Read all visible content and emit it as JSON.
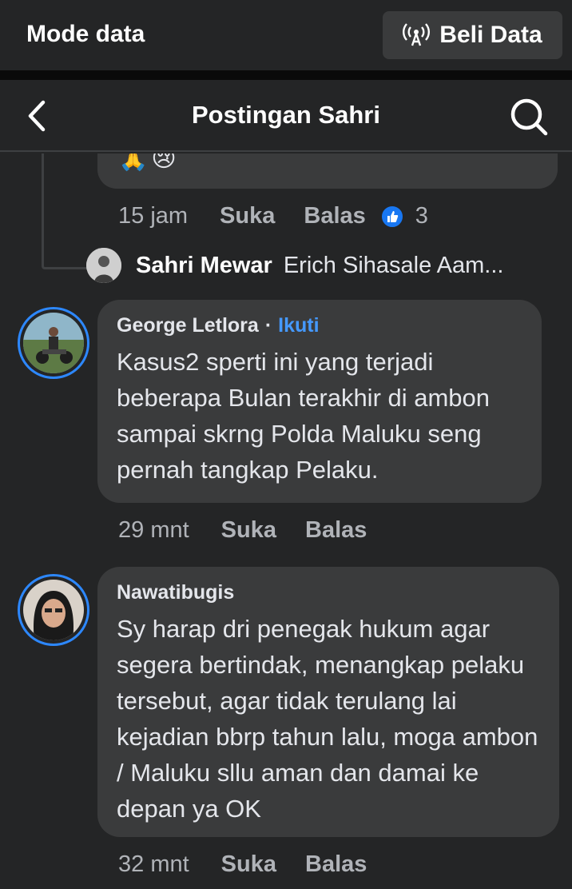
{
  "banner": {
    "title": "Mode data",
    "buy_label": "Beli Data"
  },
  "header": {
    "title": "Postingan Sahri"
  },
  "prev_comment": {
    "emojis": [
      "🙏",
      "😢"
    ],
    "time": "15 jam",
    "like_label": "Suka",
    "reply_label": "Balas",
    "reaction_count": "3"
  },
  "reply_preview": {
    "name": "Sahri Mewar",
    "text": "Erich Sihasale Aam..."
  },
  "comments": [
    {
      "author": "George Letlora",
      "separator": "·",
      "follow": "Ikuti",
      "text": "Kasus2 sperti ini yang terjadi beberapa Bulan terakhir di ambon sampai skrng Polda Maluku seng pernah tangkap Pelaku.",
      "time": "29 mnt",
      "like_label": "Suka",
      "reply_label": "Balas"
    },
    {
      "author": "Nawatibugis",
      "text": "Sy harap dri penegak hukum agar segera bertindak, menangkap pelaku tersebut, agar tidak terulang lai kejadian bbrp tahun lalu, moga ambon /  Maluku sllu aman dan damai ke depan ya OK",
      "time": "32 mnt",
      "like_label": "Suka",
      "reply_label": "Balas"
    }
  ],
  "colors": {
    "background": "#242526",
    "bubble": "#3a3b3c",
    "accent": "#2d88ff",
    "link": "#4599ff"
  }
}
